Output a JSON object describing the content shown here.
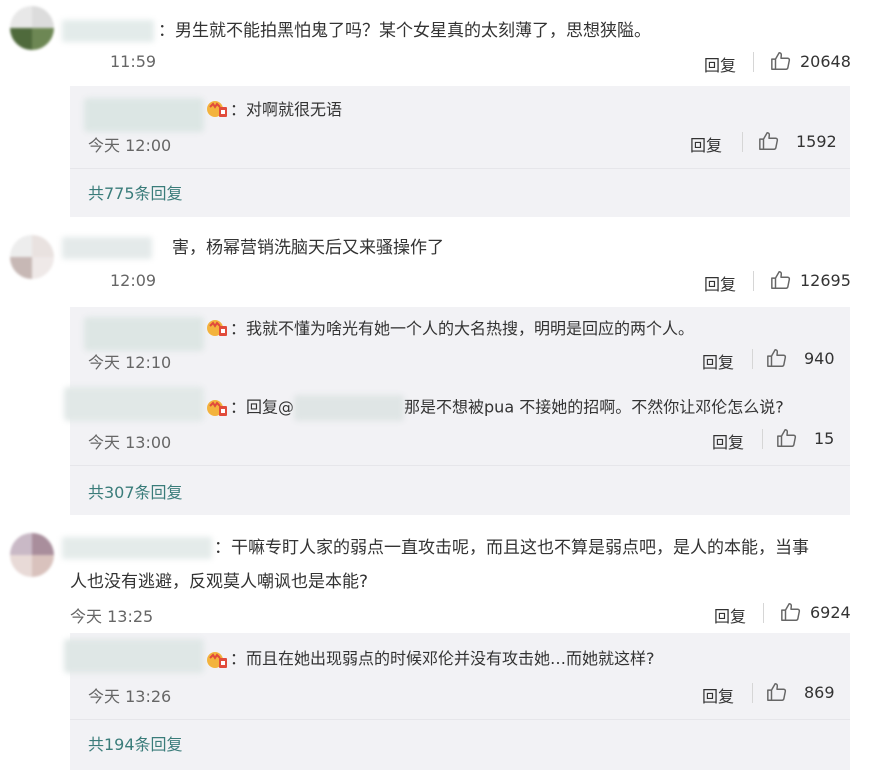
{
  "colors": {
    "link": "#3a7c7a",
    "sub_bg": "#f2f2f5",
    "text": "#333333",
    "muted": "#666666"
  },
  "comments": [
    {
      "text": "：男生就不能拍黑怕鬼了吗？某个女星真的太刻薄了，思想狭隘。",
      "time": "11:59",
      "reply_label": "回复",
      "likes": "20648",
      "replies": [
        {
          "text": "：对啊就很无语",
          "time": "今天 12:00",
          "reply_label": "回复",
          "likes": "1592"
        }
      ],
      "more": "共775条回复"
    },
    {
      "text": "害，杨幂营销洗脑天后又来骚操作了",
      "time": "12:09",
      "reply_label": "回复",
      "likes": "12695",
      "replies": [
        {
          "text": "：我就不懂为啥光有她一个人的大名热搜，明明是回应的两个人。",
          "time": "今天 12:10",
          "reply_label": "回复",
          "likes": "940"
        },
        {
          "prefix": "：回复@",
          "text": "那是不想被pua 不接她的招啊。不然你让邓伦怎么说?",
          "time": "今天 13:00",
          "reply_label": "回复",
          "likes": "15"
        }
      ],
      "more": "共307条回复"
    },
    {
      "text_line1": "：干嘛专盯人家的弱点一直攻击呢，而且这也不算是弱点吧，是人的本能，当事",
      "text_line2": "人也没有逃避，反观莫人嘲讽也是本能?",
      "time": "今天 13:25",
      "reply_label": "回复",
      "likes": "6924",
      "replies": [
        {
          "text": "：而且在她出现弱点的时候邓伦并没有攻击她…而她就这样?",
          "time": "今天 13:26",
          "reply_label": "回复",
          "likes": "869"
        }
      ],
      "more": "共194条回复"
    }
  ]
}
